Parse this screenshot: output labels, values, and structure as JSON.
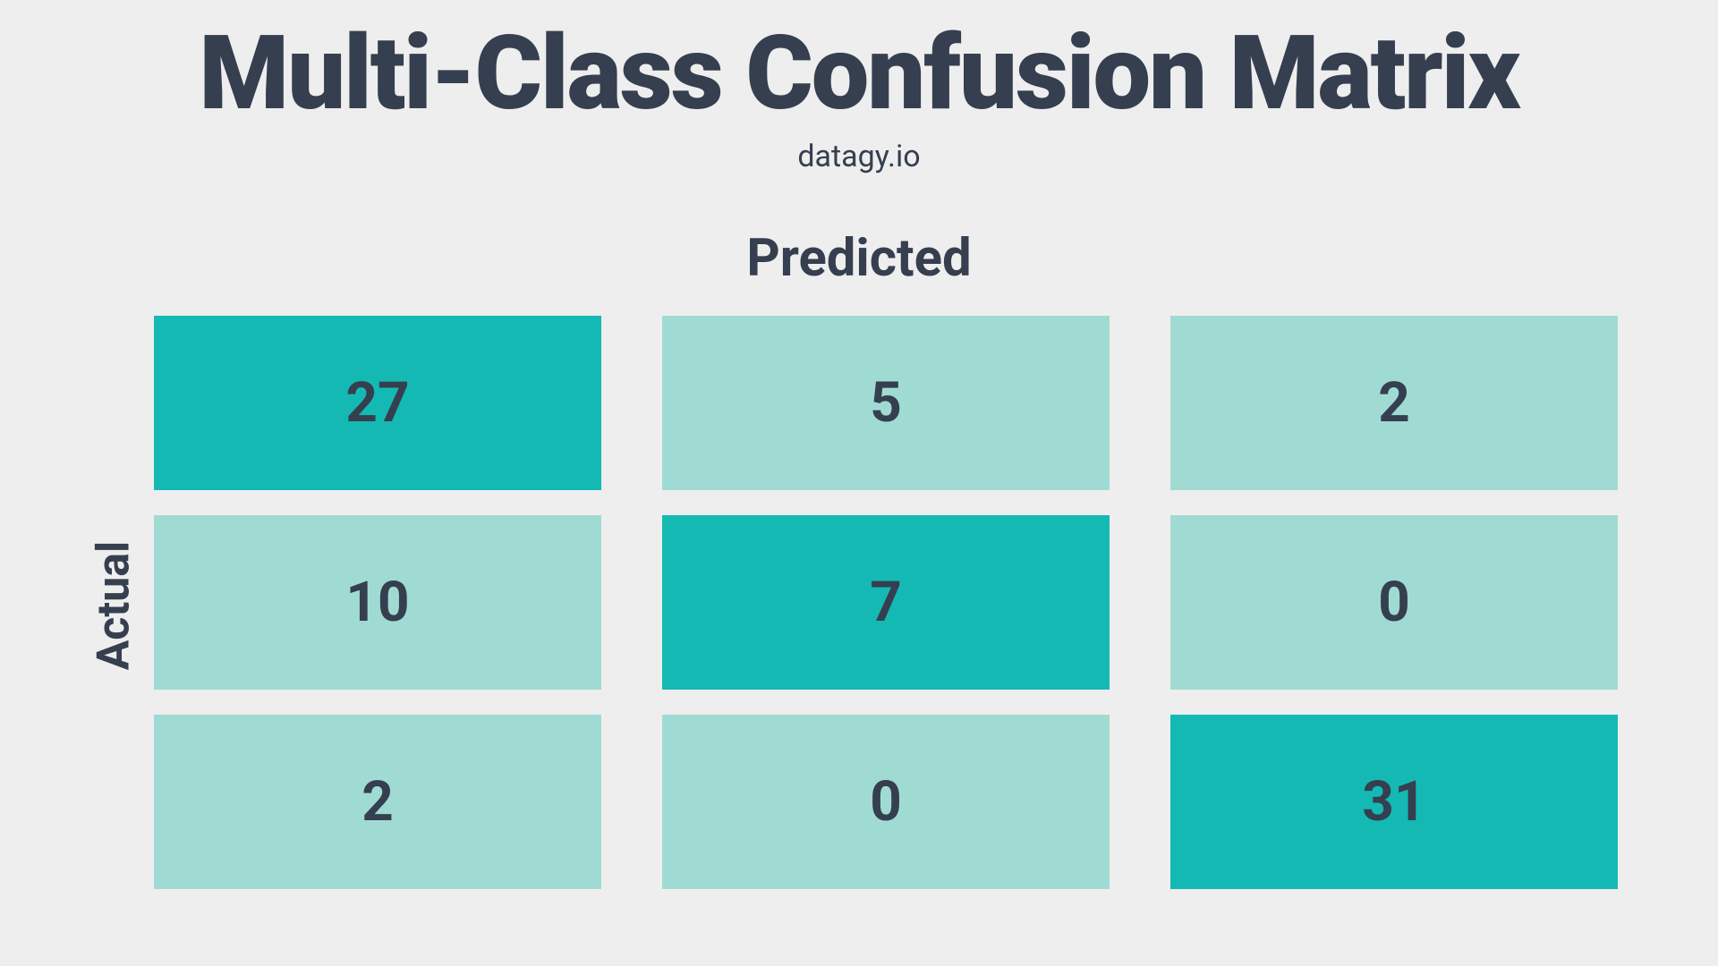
{
  "title": "Multi-Class Confusion Matrix",
  "subtitle": "datagy.io",
  "axis_top": "Predicted",
  "axis_left": "Actual",
  "colors": {
    "diagonal": "#15b9b4",
    "offdiagonal": "#a0dbd3",
    "text": "#353f4f",
    "bg": "#eeeeee"
  },
  "chart_data": {
    "type": "heatmap",
    "title": "Multi-Class Confusion Matrix",
    "xlabel": "Predicted",
    "ylabel": "Actual",
    "rows": 3,
    "cols": 3,
    "values": [
      [
        27,
        5,
        2
      ],
      [
        10,
        7,
        0
      ],
      [
        2,
        0,
        31
      ]
    ]
  }
}
